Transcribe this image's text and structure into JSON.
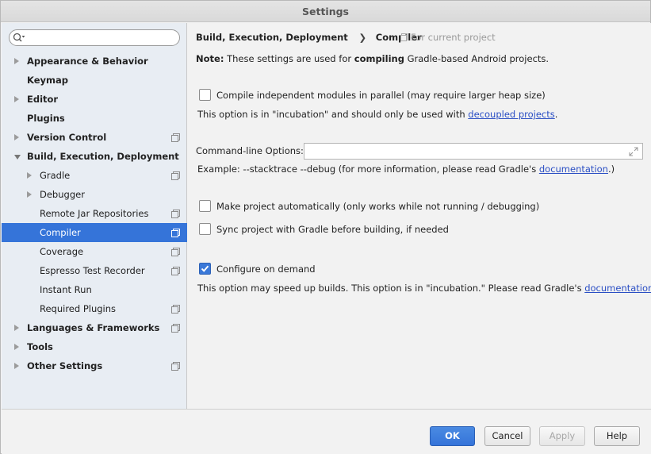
{
  "window": {
    "title": "Settings"
  },
  "search": {
    "placeholder": ""
  },
  "sidebar": {
    "items": [
      {
        "label": "Appearance & Behavior",
        "bold": true,
        "arrow": "right",
        "project": false
      },
      {
        "label": "Keymap",
        "bold": true,
        "arrow": "none",
        "project": false
      },
      {
        "label": "Editor",
        "bold": true,
        "arrow": "right",
        "project": false
      },
      {
        "label": "Plugins",
        "bold": true,
        "arrow": "none",
        "project": false
      },
      {
        "label": "Version Control",
        "bold": true,
        "arrow": "right",
        "project": true
      },
      {
        "label": "Build, Execution, Deployment",
        "bold": true,
        "arrow": "down",
        "project": false
      },
      {
        "label": "Gradle",
        "bold": false,
        "arrow": "right",
        "project": true
      },
      {
        "label": "Debugger",
        "bold": false,
        "arrow": "right",
        "project": false
      },
      {
        "label": "Remote Jar Repositories",
        "bold": false,
        "arrow": "none",
        "project": true
      },
      {
        "label": "Compiler",
        "bold": false,
        "arrow": "none",
        "project": true,
        "selected": true
      },
      {
        "label": "Coverage",
        "bold": false,
        "arrow": "none",
        "project": true
      },
      {
        "label": "Espresso Test Recorder",
        "bold": false,
        "arrow": "none",
        "project": true
      },
      {
        "label": "Instant Run",
        "bold": false,
        "arrow": "none",
        "project": false
      },
      {
        "label": "Required Plugins",
        "bold": false,
        "arrow": "none",
        "project": true
      },
      {
        "label": "Languages & Frameworks",
        "bold": true,
        "arrow": "right",
        "project": true
      },
      {
        "label": "Tools",
        "bold": true,
        "arrow": "right",
        "project": false
      },
      {
        "label": "Other Settings",
        "bold": true,
        "arrow": "right",
        "project": true
      }
    ]
  },
  "breadcrumb": {
    "parent": "Build, Execution, Deployment",
    "separator": "❯",
    "current": "Compiler",
    "scope": "For current project"
  },
  "note": {
    "prefix": "Note:",
    "text1": " These settings are used for ",
    "bold": "compiling",
    "text2": " Gradle-based Android projects."
  },
  "options": {
    "parallel": {
      "label": "Compile independent modules in parallel (may require larger heap size)",
      "checked": false,
      "hint": "This option is in \"incubation\" and should only be used with ",
      "hint_link": "decoupled projects",
      "hint_end": "."
    },
    "cmdline": {
      "label": "Command-line Options:",
      "value": "",
      "example": "Example: --stacktrace --debug (for more information, please read Gradle's ",
      "example_link": "documentation",
      "example_end": ".)"
    },
    "auto_make": {
      "label": "Make project automatically (only works while not running / debugging)",
      "checked": false
    },
    "sync": {
      "label": "Sync project with Gradle before building, if needed",
      "checked": false
    },
    "on_demand": {
      "label": "Configure on demand",
      "checked": true,
      "hint": "This option may speed up builds. This option is in \"incubation.\" Please read Gradle's ",
      "hint_link": "documentation",
      "hint_end": "."
    }
  },
  "footer": {
    "ok": "OK",
    "cancel": "Cancel",
    "apply": "Apply",
    "help": "Help"
  }
}
